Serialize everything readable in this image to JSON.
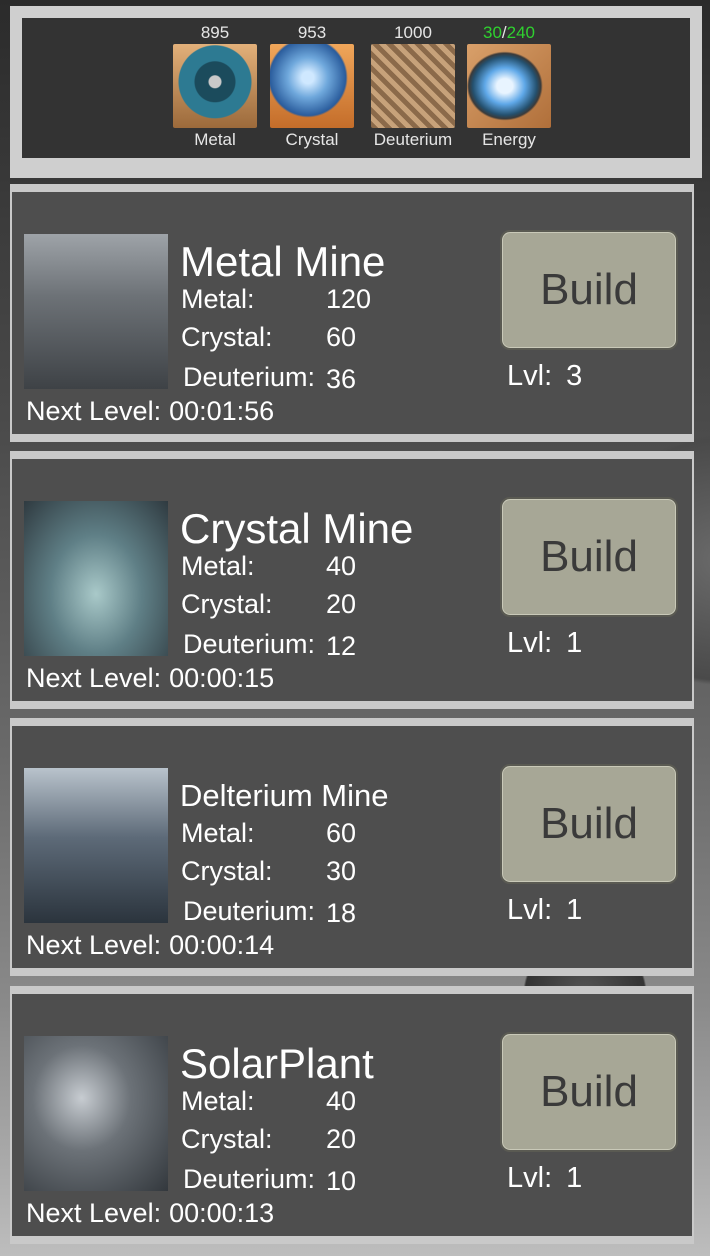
{
  "resources": [
    {
      "key": "metal",
      "label": "Metal",
      "value": "895",
      "color": "#e6e6e6",
      "icon": "metal-tank-icon"
    },
    {
      "key": "crystal",
      "label": "Crystal",
      "value": "953",
      "color": "#e6e6e6",
      "icon": "crystal-sphere-icon"
    },
    {
      "key": "deuterium",
      "label": "Deuterium",
      "value": "1000",
      "color": "#d01010",
      "icon": "deuterium-crate-icon"
    },
    {
      "key": "energy",
      "label": "Energy",
      "current": "30",
      "separator": "/",
      "max": "240",
      "current_color": "#2fd12f",
      "max_color": "#2fd12f",
      "icon": "energy-portal-icon"
    }
  ],
  "labels": {
    "metal": "Metal:",
    "crystal": "Crystal:",
    "deuterium": "Deuterium:",
    "next_level": "Next Level:",
    "level": "Lvl:",
    "build": "Build"
  },
  "buildings": [
    {
      "name": "Metal Mine",
      "metal": "120",
      "crystal": "60",
      "deuterium": "36",
      "next_level": "00:01:56",
      "level": "3"
    },
    {
      "name": "Crystal Mine",
      "metal": "40",
      "crystal": "20",
      "deuterium": "12",
      "next_level": "00:00:15",
      "level": "1"
    },
    {
      "name": "Delterium Mine",
      "metal": "60",
      "crystal": "30",
      "deuterium": "18",
      "next_level": "00:00:14",
      "level": "1"
    },
    {
      "name": "SolarPlant",
      "metal": "40",
      "crystal": "20",
      "deuterium": "10",
      "next_level": "00:00:13",
      "level": "1"
    }
  ]
}
